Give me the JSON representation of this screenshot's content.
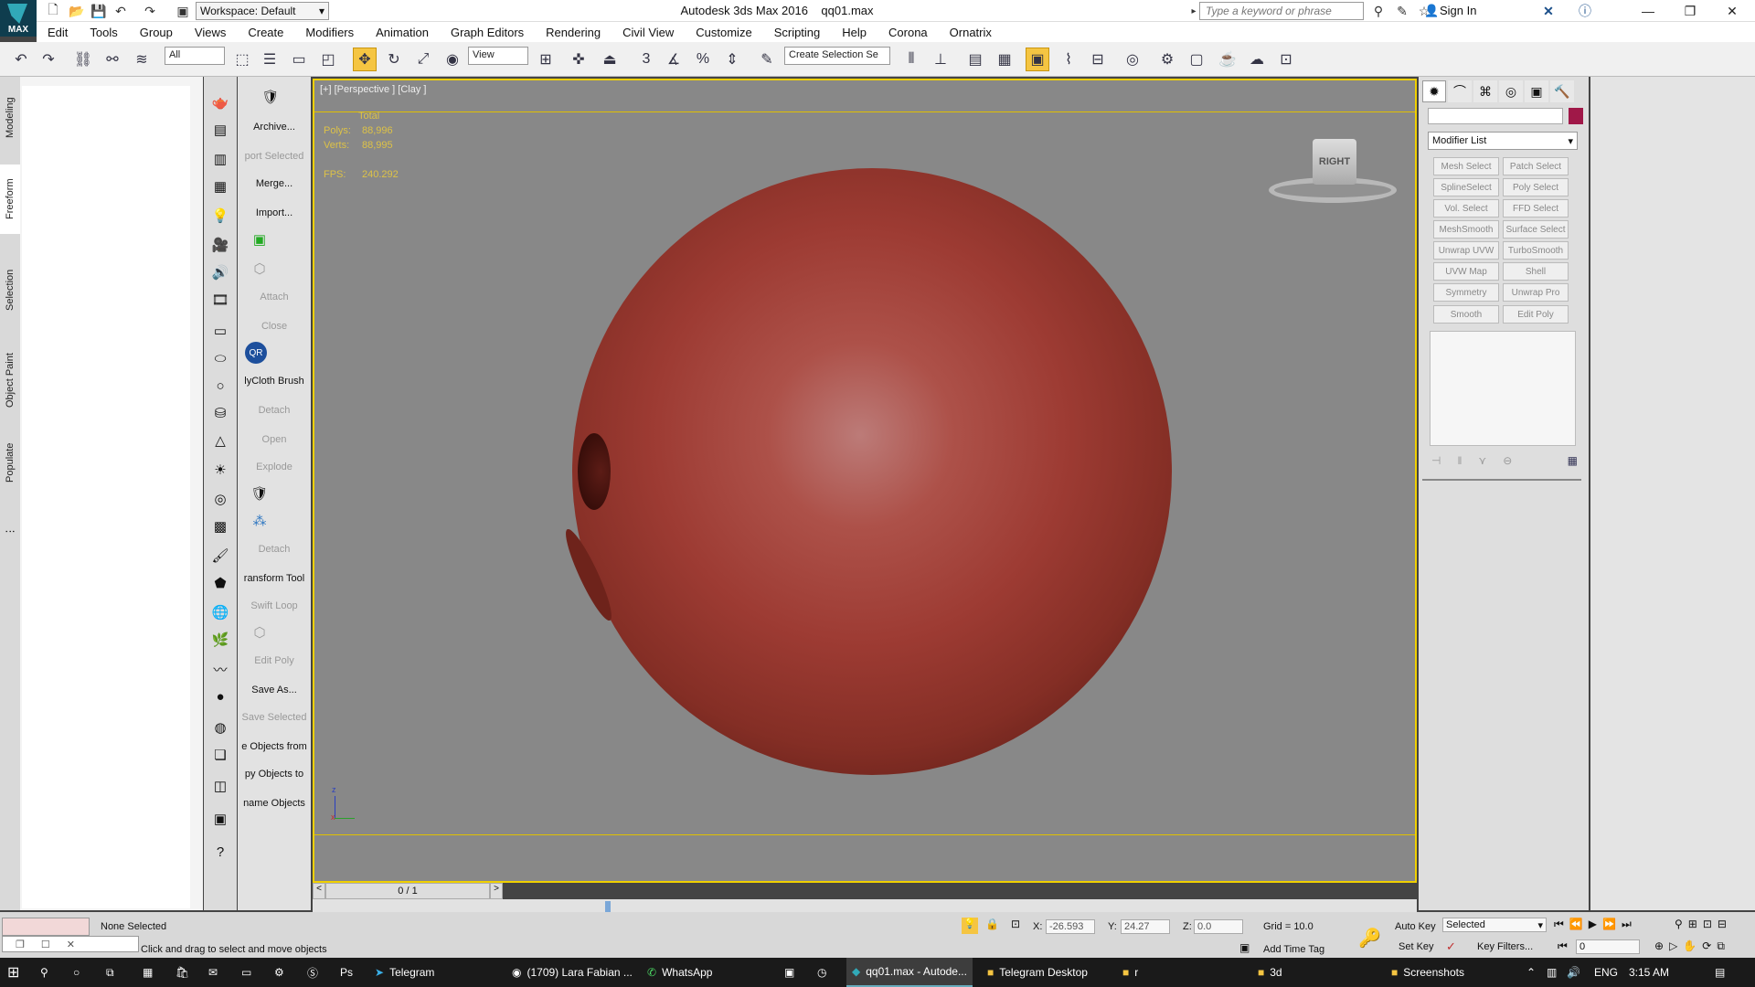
{
  "app": {
    "title": "Autodesk 3ds Max 2016",
    "file": "qq01.max",
    "logo_text": "MAX",
    "workspace": "Workspace: Default",
    "search_placeholder": "Type a keyword or phrase",
    "sign_in": "Sign In"
  },
  "menus": [
    "Edit",
    "Tools",
    "Group",
    "Views",
    "Create",
    "Modifiers",
    "Animation",
    "Graph Editors",
    "Rendering",
    "Civil View",
    "Customize",
    "Scripting",
    "Help",
    "Corona",
    "Ornatrix"
  ],
  "toolbar": {
    "filter": "All",
    "ref_coord": "View",
    "selection_set": "Create Selection Se"
  },
  "left_tabs": [
    "Modeling",
    "Freeform",
    "Selection",
    "Object Paint",
    "Populate"
  ],
  "tools": [
    {
      "label": "Archive...",
      "enabled": true
    },
    {
      "label": "port Selected",
      "enabled": false
    },
    {
      "label": "Merge...",
      "enabled": true
    },
    {
      "label": "Import...",
      "enabled": true
    },
    {
      "label": "Attach",
      "enabled": false
    },
    {
      "label": "Close",
      "enabled": false
    },
    {
      "label": "lyCloth Brush",
      "enabled": true
    },
    {
      "label": "Detach",
      "enabled": false
    },
    {
      "label": "Open",
      "enabled": false
    },
    {
      "label": "Explode",
      "enabled": false
    },
    {
      "label": "Detach",
      "enabled": false
    },
    {
      "label": "ransform Tool",
      "enabled": true
    },
    {
      "label": "Swift Loop",
      "enabled": false
    },
    {
      "label": "Edit Poly",
      "enabled": false
    },
    {
      "label": "Save As...",
      "enabled": true
    },
    {
      "label": "Save Selected",
      "enabled": false
    },
    {
      "label": "e Objects from",
      "enabled": true
    },
    {
      "label": "py Objects to",
      "enabled": true
    },
    {
      "label": "name Objects",
      "enabled": true
    }
  ],
  "viewport": {
    "label": "[+] [Perspective ] [Clay ]",
    "stats": {
      "total": "Total",
      "polys_label": "Polys:",
      "polys": "88,996",
      "verts_label": "Verts:",
      "verts": "88,995",
      "fps_label": "FPS:",
      "fps": "240.292"
    },
    "viewcube": "RIGHT"
  },
  "timeslider": "0 / 1",
  "command_panel": {
    "modifier_list": "Modifier List",
    "buttons": [
      "Mesh Select",
      "Patch Select",
      "SplineSelect",
      "Poly Select",
      "Vol. Select",
      "FFD Select",
      "MeshSmooth",
      "Surface Select",
      "Unwrap UVW",
      "TurboSmooth",
      "UVW Map",
      "Shell",
      "Symmetry",
      "Unwrap Pro",
      "Smooth",
      "Edit Poly"
    ]
  },
  "status": {
    "selection": "None Selected",
    "prompt": "Click and drag to select and move objects",
    "x_label": "X:",
    "x": "-26.593",
    "y_label": "Y:",
    "y": "24.27",
    "z_label": "Z:",
    "z": "0.0",
    "grid": "Grid = 10.0",
    "add_time_tag": "Add Time Tag",
    "auto_key": "Auto Key",
    "set_key": "Set Key",
    "selected": "Selected",
    "key_filters": "Key Filters...",
    "frame": "0"
  },
  "taskbar": {
    "items": [
      "Telegram",
      "(1709) Lara Fabian ...",
      "WhatsApp",
      "qq01.max - Autode...",
      "Telegram Desktop",
      "r",
      "3d",
      "Screenshots"
    ],
    "lang": "ENG",
    "time": "3:15 AM"
  }
}
